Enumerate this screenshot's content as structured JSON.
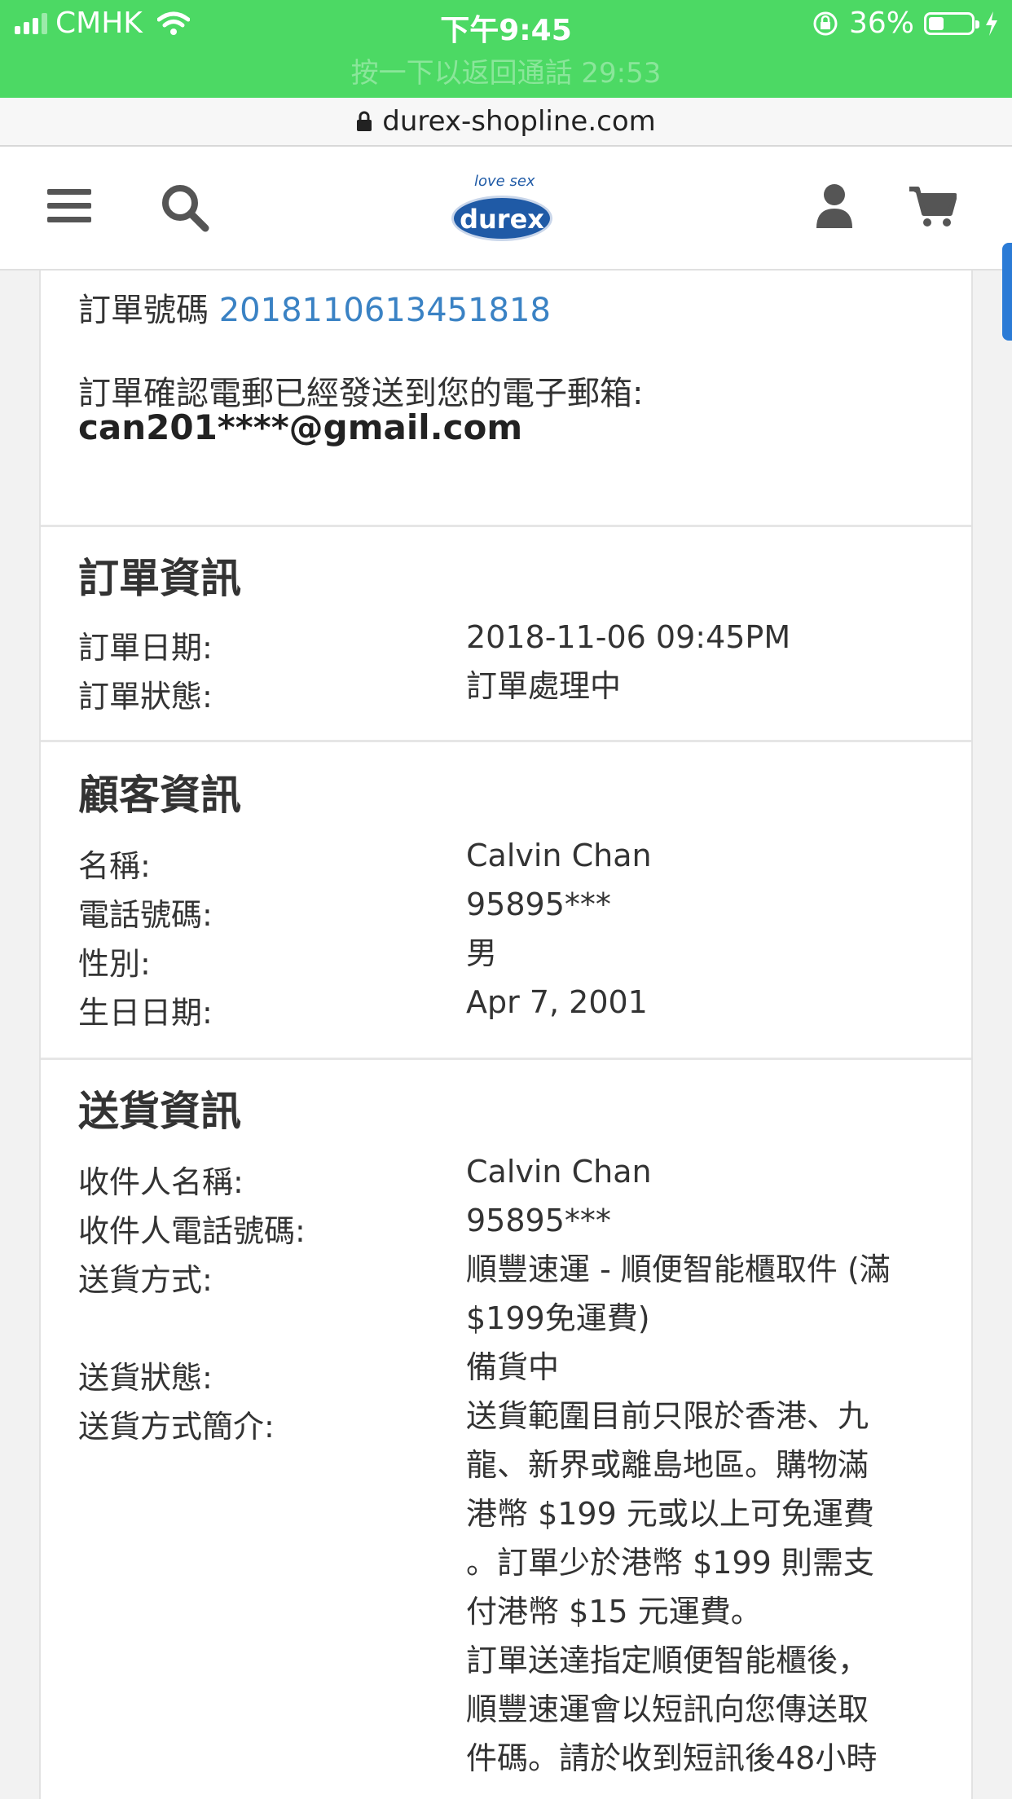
{
  "status_bar": {
    "carrier": "CMHK",
    "time": "下午9:45",
    "battery": "36%",
    "battery_level": 0.36,
    "call_banner": "按一下以返回通話 29:53"
  },
  "browser": {
    "url": "durex-shopline.com"
  },
  "header": {
    "logo_tagline": "love sex",
    "logo_brand": "durex"
  },
  "order": {
    "number_label": "訂單號碼",
    "number": "20181106134518​18",
    "email_note": "訂單確認電郵已經發送到您的電子郵箱:",
    "email": "can201****@gmail.com"
  },
  "order_info": {
    "title": "訂單資訊",
    "rows": [
      {
        "label": "訂單日期:",
        "value": "2018-11-06 09:45PM"
      },
      {
        "label": "訂單狀態:",
        "value": "訂單處理中"
      }
    ]
  },
  "customer_info": {
    "title": "顧客資訊",
    "rows": [
      {
        "label": "名稱:",
        "value": "Calvin Chan"
      },
      {
        "label": "電話號碼:",
        "value": "95895***"
      },
      {
        "label": "性別:",
        "value": "男"
      },
      {
        "label": "生日日期:",
        "value": "Apr 7, 2001"
      }
    ]
  },
  "delivery_info": {
    "title": "送貨資訊",
    "rows": [
      {
        "label": "收件人名稱:",
        "value": "Calvin Chan"
      },
      {
        "label": "收件人電話號碼:",
        "value": "95895***"
      },
      {
        "label": "送貨方式:",
        "value_lines": [
          "順豐速運 - 順便智能櫃取件 (滿",
          "$199免運費)"
        ]
      },
      {
        "label": "送貨狀態:",
        "value": "備貨中"
      },
      {
        "label": "送貨方式簡介:",
        "value_lines": [
          "送貨範圍目前只限於香港、九",
          "龍、新界或離島地區。購物滿",
          "港幣 $199 元或以上可免運費",
          "。訂單少於港幣 $199 則需支",
          "付港幣 $15 元運費。",
          "訂單送達指定順便智能櫃後，",
          "順豐速運會以短訊向您傳送取",
          "件碼。請於收到短訊後48小時"
        ]
      }
    ]
  }
}
